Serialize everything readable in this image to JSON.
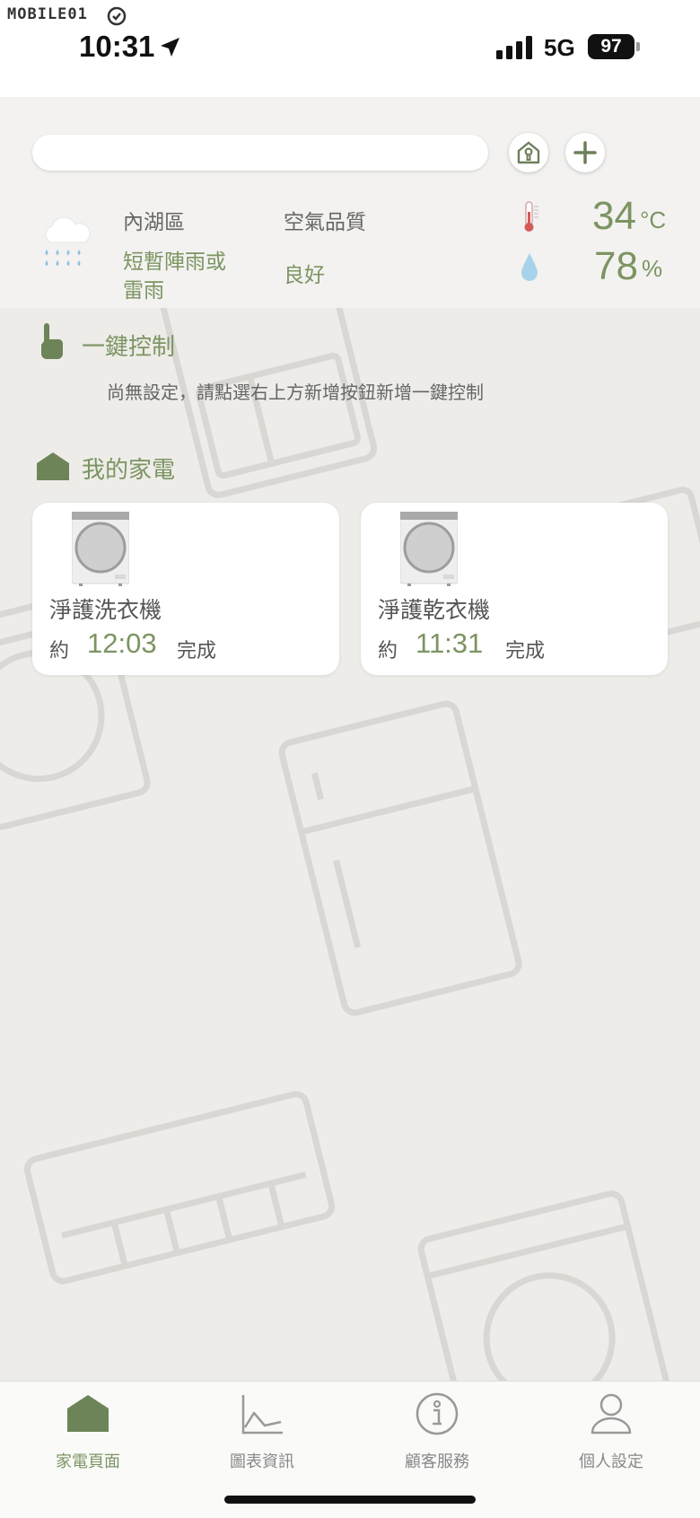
{
  "watermark": {
    "text": "MOBILE01"
  },
  "status_bar": {
    "time": "10:31",
    "network": "5G",
    "battery": "97"
  },
  "header": {
    "search": {
      "value": "",
      "placeholder": ""
    }
  },
  "weather": {
    "district": "內湖區",
    "condition_line1": "短暫陣雨或",
    "condition_line2": "雷雨",
    "air_quality_label": "空氣品質",
    "air_quality_value": "良好",
    "temperature": "34",
    "temperature_unit": "°C",
    "humidity": "78",
    "humidity_unit": "%"
  },
  "one_click": {
    "title": "一鍵控制",
    "empty_message": "尚無設定，請點選右上方新增按鈕新增一鍵控制"
  },
  "appliances": {
    "title": "我的家電",
    "items": [
      {
        "name": "淨護洗衣機",
        "prefix": "約",
        "time": "12:03",
        "suffix": "完成"
      },
      {
        "name": "淨護乾衣機",
        "prefix": "約",
        "time": "11:31",
        "suffix": "完成"
      }
    ]
  },
  "tabbar": {
    "items": [
      {
        "label": "家電頁面",
        "icon": "home-icon",
        "active": true
      },
      {
        "label": "圖表資訊",
        "icon": "chart-icon",
        "active": false
      },
      {
        "label": "顧客服務",
        "icon": "info-icon",
        "active": false
      },
      {
        "label": "個人設定",
        "icon": "person-icon",
        "active": false
      }
    ]
  },
  "colors": {
    "accent": "#7c9462",
    "background": "#edece8",
    "header": "#f3f2f0",
    "card": "#ffffff"
  }
}
